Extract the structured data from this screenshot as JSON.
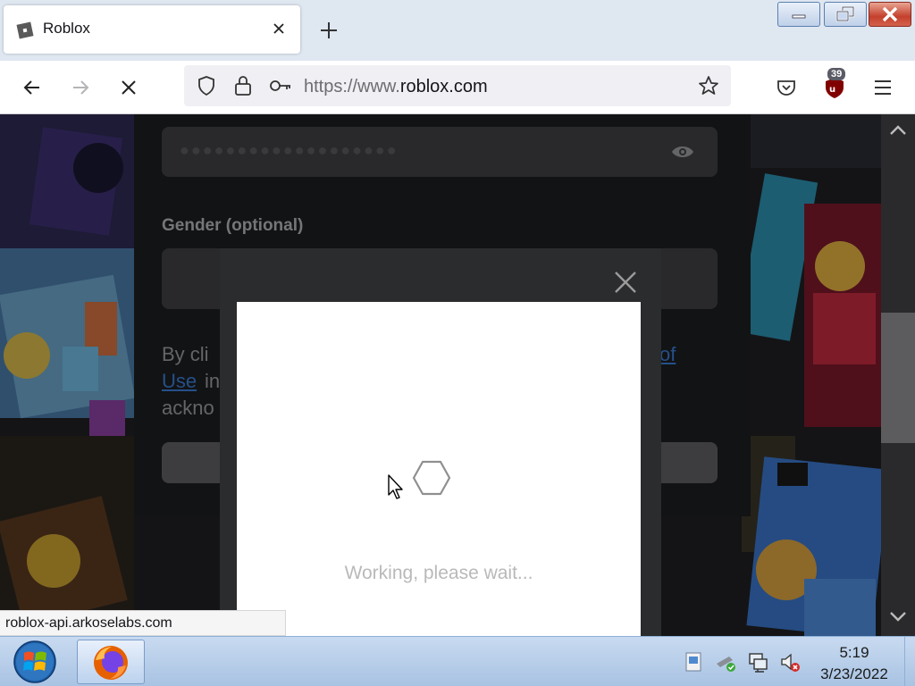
{
  "browser": {
    "tab": {
      "title": "Roblox"
    },
    "url": {
      "prefix": "https://www.",
      "domain": "roblox.com"
    },
    "extension_badge": "39"
  },
  "page": {
    "password_mask": "●●●●●●●●●●●●●●●●●●●",
    "gender_label": "Gender (optional)",
    "terms_line1": "By cli",
    "terms_of": "of",
    "terms_use": "Use",
    "terms_in": "in",
    "terms_line3": "ackno"
  },
  "captcha": {
    "status": "Working, please wait..."
  },
  "status_tooltip": "roblox-api.arkoselabs.com",
  "taskbar": {
    "time": "5:19",
    "date": "3/23/2022"
  },
  "colors": {
    "link": "#3a7bd5",
    "page_bg": "#1f2022",
    "taskbar": "#bcd2ee"
  }
}
